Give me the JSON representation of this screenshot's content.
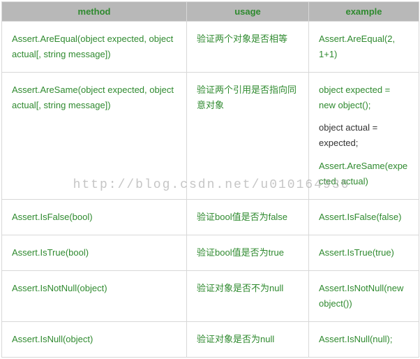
{
  "headers": {
    "c1": "method",
    "c2": "usage",
    "c3": "example"
  },
  "rows": [
    {
      "method": "Assert.AreEqual(object expected, object actual[, string message])",
      "usage": "验证两个对象是否相等",
      "example": [
        {
          "text": "Assert.AreEqual(2, 1+1)",
          "plain": false
        }
      ]
    },
    {
      "method": "Assert.AreSame(object expected, object actual[, string message])",
      "usage": "验证两个引用是否指向同意对象",
      "example": [
        {
          "text": "object expected = new object();",
          "plain": false
        },
        {
          "text": "object actual = expected;",
          "plain": true
        },
        {
          "text": "Assert.AreSame(expected, actual)",
          "plain": false
        }
      ]
    },
    {
      "method": "Assert.IsFalse(bool)",
      "usage": "验证bool值是否为false",
      "example": [
        {
          "text": "Assert.IsFalse(false)",
          "plain": false
        }
      ]
    },
    {
      "method": "Assert.IsTrue(bool)",
      "usage": "验证bool值是否为true",
      "example": [
        {
          "text": "Assert.IsTrue(true)",
          "plain": false
        }
      ]
    },
    {
      "method": "Assert.IsNotNull(object)",
      "usage": "验证对象是否不为null",
      "example": [
        {
          "text": "Assert.IsNotNull(new object())",
          "plain": false
        }
      ]
    },
    {
      "method": "Assert.IsNull(object)",
      "usage": "验证对象是否为null",
      "example": [
        {
          "text": "Assert.IsNull(null);",
          "plain": false
        }
      ]
    }
  ],
  "watermark": "http://blog.csdn.net/u010164936"
}
